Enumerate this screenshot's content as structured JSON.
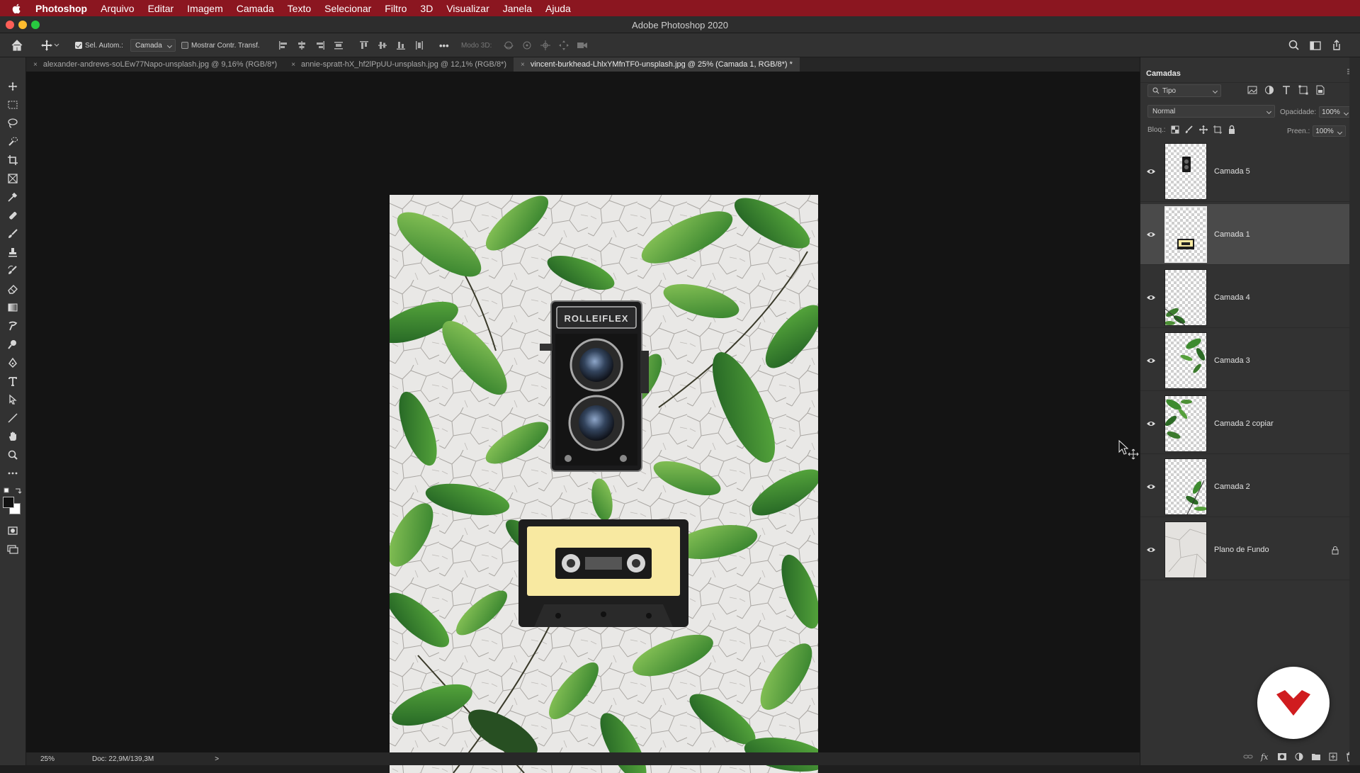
{
  "menubar": {
    "app_name": "Photoshop",
    "items": [
      "Arquivo",
      "Editar",
      "Imagem",
      "Camada",
      "Texto",
      "Selecionar",
      "Filtro",
      "3D",
      "Visualizar",
      "Janela",
      "Ajuda"
    ]
  },
  "window": {
    "title": "Adobe Photoshop 2020",
    "traffic_colors": [
      "#fe5f57",
      "#febc2e",
      "#28c840"
    ]
  },
  "options": {
    "auto_select_label": "Sel. Autom.:",
    "auto_select_checked": true,
    "auto_select_target": "Camada",
    "show_transform_label": "Mostrar Contr. Transf.",
    "show_transform_checked": false,
    "mode3d_label": "Modo 3D:",
    "more_label": "•••"
  },
  "tabs": [
    {
      "label": "alexander-andrews-soLEw77Napo-unsplash.jpg @ 9,16% (RGB/8*)",
      "active": false
    },
    {
      "label": "annie-spratt-hX_hf2lPpUU-unsplash.jpg @ 12,1% (RGB/8*)",
      "active": false
    },
    {
      "label": "vincent-burkhead-LhlxYMfnTF0-unsplash.jpg @ 25% (Camada 1, RGB/8*) *",
      "active": true
    }
  ],
  "status": {
    "zoom": "25%",
    "doc_info": "Doc: 22,9M/139,3M",
    "arrow": ">"
  },
  "layers_panel": {
    "title": "Camadas",
    "filter_kind": "Tipo",
    "blend_mode": "Normal",
    "opacity_label": "Opacidade:",
    "opacity_value": "100%",
    "lock_label": "Bloq.:",
    "fill_label": "Preen.:",
    "fill_value": "100%",
    "layers": [
      {
        "name": "Camada 5",
        "visible": true,
        "selected": false,
        "locked": false,
        "thumb": "camera"
      },
      {
        "name": "Camada 1",
        "visible": true,
        "selected": true,
        "locked": false,
        "thumb": "cassette"
      },
      {
        "name": "Camada 4",
        "visible": true,
        "selected": false,
        "locked": false,
        "thumb": "leaves-bottom-left"
      },
      {
        "name": "Camada 3",
        "visible": true,
        "selected": false,
        "locked": false,
        "thumb": "leaves-top"
      },
      {
        "name": "Camada 2 copiar",
        "visible": true,
        "selected": false,
        "locked": false,
        "thumb": "leaves-left"
      },
      {
        "name": "Camada 2",
        "visible": true,
        "selected": false,
        "locked": false,
        "thumb": "leaves-right"
      },
      {
        "name": "Plano de Fundo",
        "visible": true,
        "selected": false,
        "locked": true,
        "thumb": "background"
      }
    ]
  },
  "colors": {
    "menubar": "#8b1620",
    "badge_red": "#d01c1f",
    "cassette_label": "#f8e9a1"
  }
}
